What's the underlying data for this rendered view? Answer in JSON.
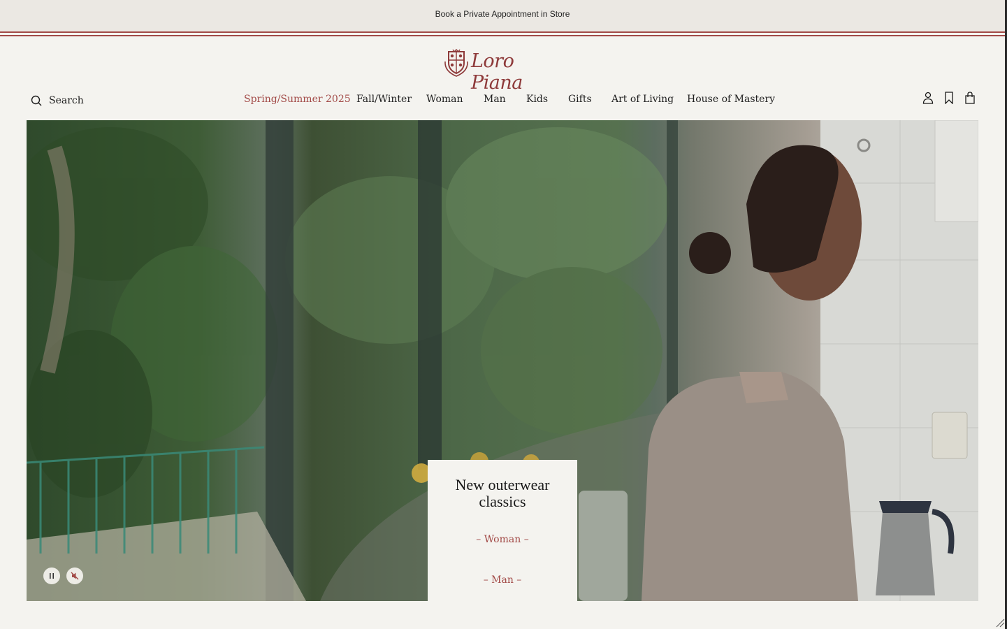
{
  "announcement": {
    "text": "Book a Private Appointment in Store"
  },
  "brand": {
    "name": "Loro Piana",
    "accent_color": "#a24a47"
  },
  "header": {
    "search_label": "Search",
    "nav": [
      {
        "label": "Spring/Summer 2025",
        "active": true
      },
      {
        "label": "Fall/Winter",
        "active": false
      },
      {
        "label": "Woman",
        "active": false
      },
      {
        "label": "Man",
        "active": false
      },
      {
        "label": "Kids",
        "active": false
      },
      {
        "label": "Gifts",
        "active": false
      },
      {
        "label": "Art of Living",
        "active": false
      },
      {
        "label": "House of Mastery",
        "active": false
      }
    ],
    "utility_icons": [
      "account-icon",
      "wishlist-icon",
      "bag-icon"
    ]
  },
  "hero": {
    "promo": {
      "title": "New outerwear classics",
      "links": [
        {
          "label": "– Woman –"
        },
        {
          "label": "– Man –"
        }
      ]
    },
    "controls": [
      "pause-icon",
      "mute-icon"
    ]
  }
}
